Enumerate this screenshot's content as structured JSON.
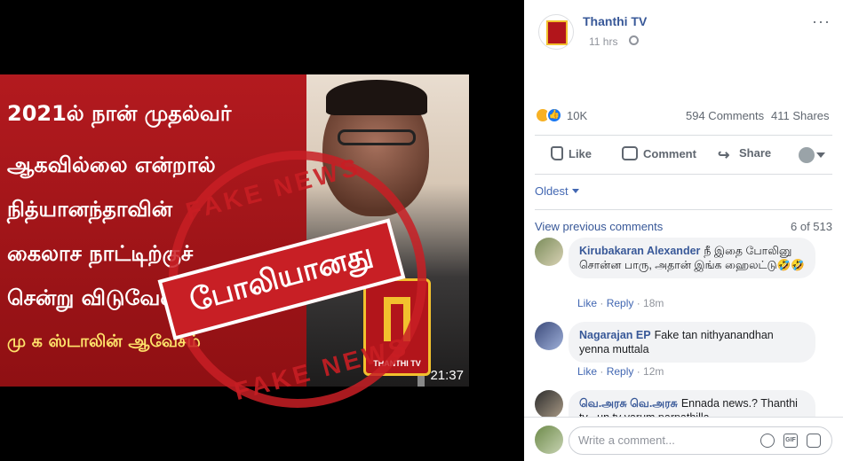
{
  "video": {
    "lines": [
      "2021ல் நான் முதல்வர்",
      "ஆகவில்லை என்றால்",
      "நித்யானந்தாவின்",
      "கைலாச நாட்டிற்குச்",
      "சென்று விடுவேன்"
    ],
    "byline": "மு க ஸ்டாலின் ஆவேசம்",
    "duration": "21:37",
    "logo_label": "THANTHI TV",
    "stamp_ring_top": "FAKE NEWS",
    "stamp_ring_bottom": "FAKE NEWS",
    "stamp_banner": "போலியானது"
  },
  "post": {
    "page_name": "Thanthi TV",
    "time": "11 hrs",
    "more": "···",
    "reactions_count": "10K",
    "comments_count": "594 Comments",
    "shares_count": "411 Shares",
    "actions": {
      "like": "Like",
      "comment": "Comment",
      "share": "Share"
    }
  },
  "comments_section": {
    "sort": "Oldest",
    "view_previous": "View previous comments",
    "page_count": "6 of 513",
    "items": [
      {
        "name": "Kirubakaran Alexander",
        "text": "நீ இதை போலினு சொன்ன பாரு, அதான் இங்க ஹைலட்டு🤣🤣",
        "like": "Like",
        "reply": "Reply",
        "time": "18m"
      },
      {
        "name": "Nagarajan EP",
        "text": "Fake tan nithyanandhan yenna muttala",
        "like": "Like",
        "reply": "Reply",
        "time": "12m"
      },
      {
        "name": "வெ.அரசு வெ.அரசு",
        "text": "Ennada news.? Thanthi tv , un tv varum parpathilla",
        "like": "",
        "reply": "",
        "time": ""
      }
    ],
    "write_placeholder": "Write a comment...",
    "gif_label": "GIF"
  },
  "colors": {
    "link": "#385898",
    "accent": "#1877f2",
    "brand_red": "#b2151b"
  },
  "icons": [
    "globe-icon",
    "like-icon",
    "comment-icon",
    "share-icon",
    "emoji-icon",
    "gif-icon",
    "sticker-icon"
  ]
}
